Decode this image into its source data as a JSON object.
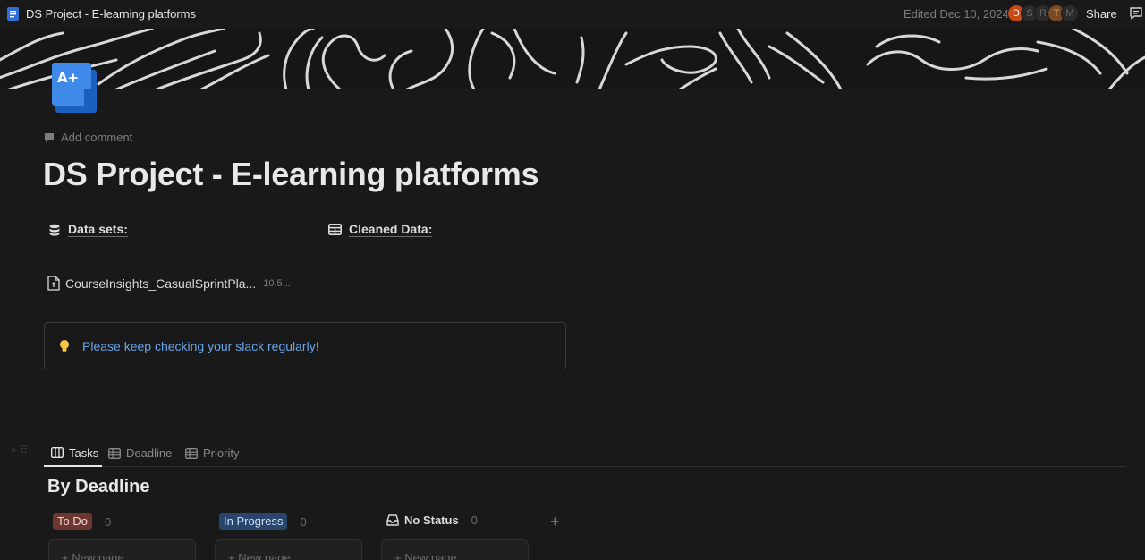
{
  "window": {
    "title": "DS Project - E-learning platforms",
    "edited": "Edited Dec 10, 2024",
    "share_label": "Share",
    "avatars": [
      "D",
      "S",
      "R",
      "T",
      "M"
    ]
  },
  "page": {
    "add_comment": "Add comment",
    "title": "DS Project - E-learning platforms",
    "properties": [
      {
        "label": "Data sets:",
        "icon": "database-icon"
      },
      {
        "label": "Cleaned Data:",
        "icon": "table-icon"
      }
    ],
    "file": {
      "name": "CourseInsights_CasualSprintPla...",
      "size": "10.5..."
    },
    "callout": {
      "icon": "lightbulb-icon",
      "text": "Please keep checking your slack regularly!"
    }
  },
  "views": {
    "tabs": [
      {
        "label": "Tasks",
        "icon": "board-icon",
        "active": true
      },
      {
        "label": "Deadline",
        "icon": "table-icon",
        "active": false
      },
      {
        "label": "Priority",
        "icon": "table-icon",
        "active": false
      }
    ]
  },
  "board": {
    "title": "By Deadline",
    "columns": [
      {
        "label": "To Do",
        "count": "0"
      },
      {
        "label": "In Progress",
        "count": "0"
      },
      {
        "label": "No Status",
        "count": "0"
      }
    ],
    "new_page_label": "+ New page"
  },
  "colors": {
    "background": "#191919",
    "todo": "#6e3630",
    "in_progress": "#28456c",
    "link": "#6aa3e8"
  }
}
